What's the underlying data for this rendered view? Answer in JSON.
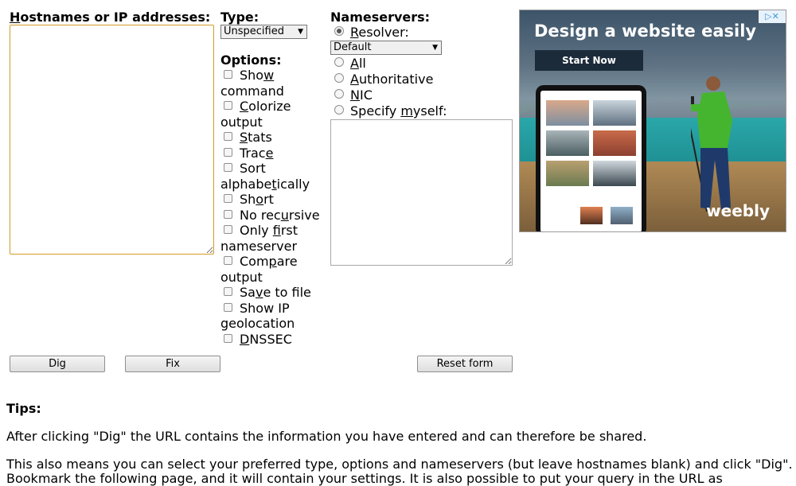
{
  "hostnames": {
    "label_prefix": "H",
    "label_rest": "ostnames or IP addresses:",
    "value": ""
  },
  "type": {
    "label": "Type:",
    "selected": "Unspecified"
  },
  "options": {
    "heading": "Options:",
    "items": [
      {
        "parts": [
          "Sho",
          "w",
          ""
        ],
        "wrap": "command",
        "checked": false
      },
      {
        "parts": [
          "",
          "C",
          "olorize"
        ],
        "wrap": "output",
        "checked": false
      },
      {
        "parts": [
          "",
          "S",
          "tats"
        ],
        "wrap": "",
        "checked": false
      },
      {
        "parts": [
          "Trac",
          "e",
          ""
        ],
        "wrap": "",
        "checked": false
      },
      {
        "parts": [
          "Sort",
          "",
          ""
        ],
        "wrap_parts": [
          "alphabe",
          "t",
          "ically"
        ],
        "checked": false
      },
      {
        "parts": [
          "Sh",
          "o",
          "rt"
        ],
        "wrap": "",
        "checked": false
      },
      {
        "parts": [
          "No rec",
          "u",
          "rsive"
        ],
        "wrap": "",
        "checked": false
      },
      {
        "parts": [
          "Only ",
          "f",
          "irst"
        ],
        "wrap": "nameserver",
        "checked": false
      },
      {
        "parts": [
          "Com",
          "p",
          "are"
        ],
        "wrap": "output",
        "checked": false
      },
      {
        "parts": [
          "Sa",
          "v",
          "e to file"
        ],
        "wrap": "",
        "checked": false
      },
      {
        "parts": [
          "Show IP",
          "",
          ""
        ],
        "wrap": "geolocation",
        "checked": false
      },
      {
        "parts": [
          "",
          "D",
          "NSSEC"
        ],
        "wrap": "",
        "checked": false
      }
    ]
  },
  "nameservers": {
    "heading": "Nameservers:",
    "resolver": {
      "prefix": "",
      "key": "R",
      "rest": "esolver:",
      "checked": true
    },
    "resolver_select": "Default",
    "all": {
      "prefix": "",
      "key": "A",
      "rest": "ll",
      "checked": false
    },
    "authoritative": {
      "prefix": "",
      "key": "A",
      "rest": "uthoritative",
      "checked": false
    },
    "nic": {
      "prefix": "",
      "key": "N",
      "rest": "IC",
      "checked": false
    },
    "specify": {
      "prefix": "Specify ",
      "key": "m",
      "rest": "yself:",
      "checked": false
    },
    "value": ""
  },
  "buttons": {
    "dig": "Dig",
    "fix": "Fix",
    "reset": "Reset form"
  },
  "tips": {
    "heading": "Tips:",
    "p1": "After clicking \"Dig\" the URL contains the information you have entered and can therefore be shared.",
    "p2": "This also means you can select your preferred type, options and nameservers (but leave hostnames blank) and click \"Dig\".",
    "p3": "Bookmark the following page, and it will contain your settings. It is also possible to put your query in the URL as"
  },
  "ad": {
    "headline": "Design a website easily",
    "cta": "Start Now",
    "brand": "weebly",
    "adchoices": "▷✕"
  }
}
